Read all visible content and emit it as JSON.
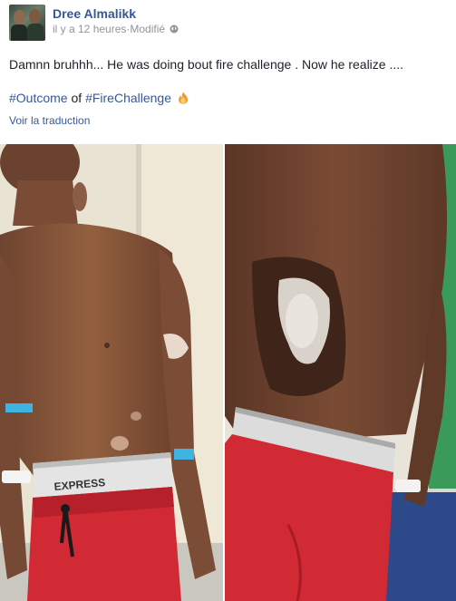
{
  "post": {
    "author": "Dree Almalikk",
    "timestamp": "il y a 12 heures",
    "separator": " · ",
    "edited": "Modifié",
    "privacy_icon": "globe-icon",
    "body_text": "Damnn bruhhh... He was doing bout fire challenge . Now he realize ....",
    "hashtag_1": "#Outcome",
    "word_of": " of ",
    "hashtag_2": "#FireChallenge",
    "emoji_icon": "fire-emoji-icon",
    "translate_link": "Voir la traduction"
  },
  "photos": [
    {
      "alt": "photo-front",
      "brand_text": "EXPRESS"
    },
    {
      "alt": "photo-back"
    }
  ],
  "colors": {
    "link": "#365899",
    "text": "#1d2129",
    "meta": "#90949c",
    "shorts_red": "#d12a35"
  }
}
